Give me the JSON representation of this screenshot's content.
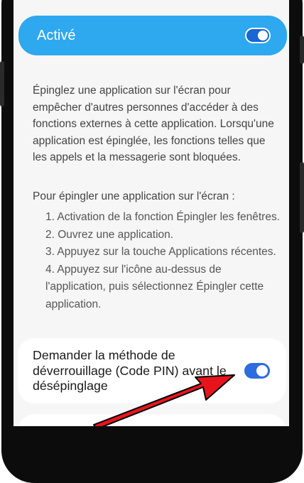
{
  "active_card": {
    "label": "Activé",
    "toggle_on": true
  },
  "description": "Épinglez une application sur l'écran pour empêcher d'autres personnes d'accéder à des fonctions externes à cette application. Lorsqu'une application est épinglée, les fonctions telles que les appels et la messagerie sont bloquées.",
  "instructions": {
    "title": "Pour épingler une application sur l'écran :",
    "steps": [
      "1. Activation de la fonction Épingler les fenêtres.",
      "2. Ouvrez une application.",
      "3. Appuyez sur la touche Applications récentes.",
      "4. Appuyez sur l'icône au-dessus de l'application, puis sélectionnez Épingler cette application."
    ]
  },
  "pin_setting": {
    "label": "Demander la méthode de déverrouillage (Code PIN) avant le désépinglage",
    "toggle_on": true
  },
  "colors": {
    "accent": "#2ea8ef",
    "toggle": "#2d6cdf",
    "annotation_arrow": "#e8141c"
  }
}
